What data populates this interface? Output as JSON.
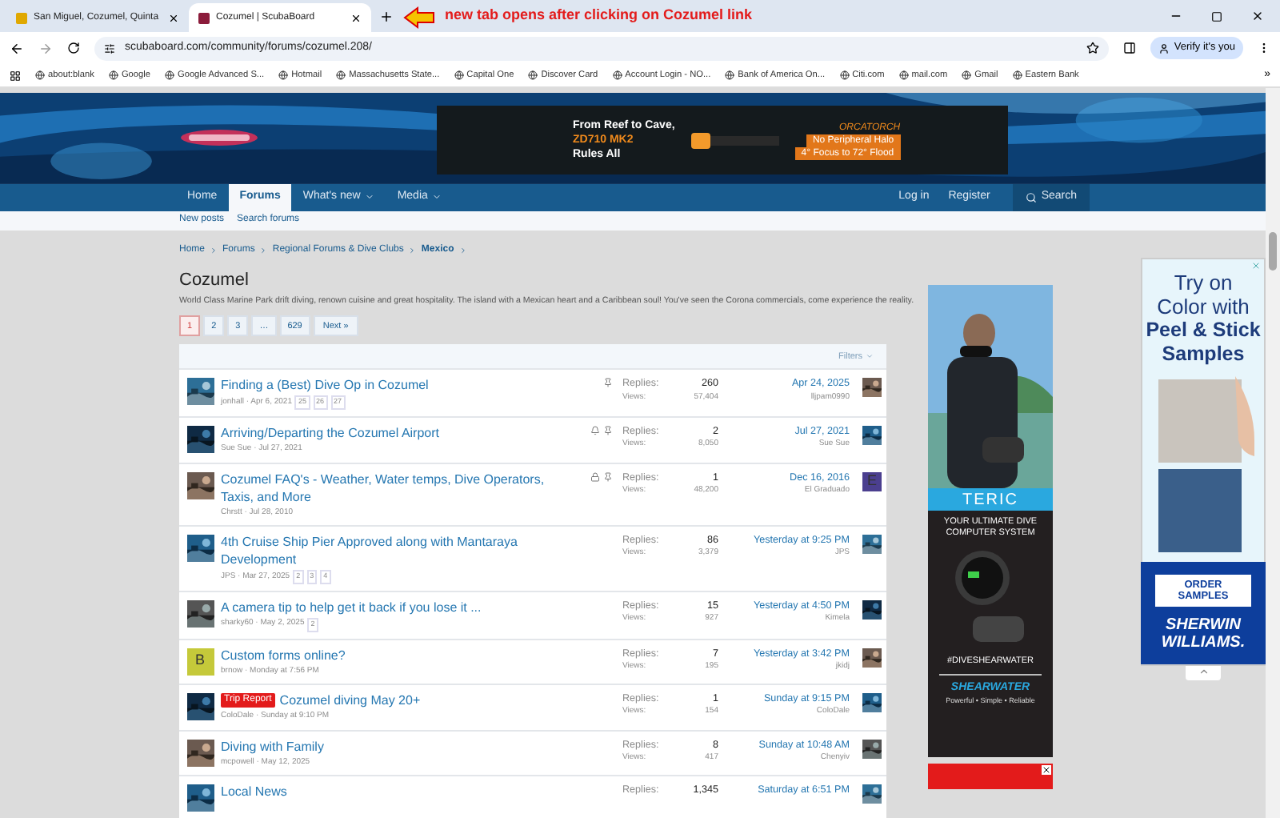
{
  "browser": {
    "tabs": [
      {
        "title": "San Miguel, Cozumel, Quinta",
        "selected": false
      },
      {
        "title": "Cozumel | ScubaBoard",
        "selected": true
      }
    ],
    "annotation": "new tab opens after clicking on Cozumel link",
    "url": "scubaboard.com/community/forums/cozumel.208/",
    "profile_button": "Verify it's you",
    "bookmarks": [
      "about:blank",
      "Google",
      "Google Advanced S...",
      "Hotmail",
      "Massachusetts State...",
      "Capital One",
      "Discover Card",
      "Account Login - NO...",
      "Bank of America On...",
      "Citi.com",
      "mail.com",
      "Gmail",
      "Eastern Bank"
    ],
    "bookmarks_overflow": "»"
  },
  "banner_ad": {
    "headline": "From Reef to Cave,",
    "model": "ZD710 MK2",
    "tagline": "Rules All",
    "brand": "ORCATORCH",
    "feature_1": "No Peripheral Halo",
    "feature_2": "4° Focus to 72° Flood"
  },
  "nav": {
    "items": [
      {
        "label": "Home",
        "selected": false,
        "menu": false
      },
      {
        "label": "Forums",
        "selected": true,
        "menu": false
      },
      {
        "label": "What's new",
        "selected": false,
        "menu": true
      },
      {
        "label": "Media",
        "selected": false,
        "menu": true
      }
    ],
    "login": "Log in",
    "register": "Register",
    "search": "Search",
    "sub_items": [
      "New posts",
      "Search forums"
    ]
  },
  "breadcrumbs": [
    {
      "label": "Home",
      "current": false
    },
    {
      "label": "Forums",
      "current": false
    },
    {
      "label": "Regional Forums & Dive Clubs",
      "current": false
    },
    {
      "label": "Mexico",
      "current": true
    }
  ],
  "title": "Cozumel",
  "description": "World Class Marine Park drift diving, renown cuisine and great hospitality. The island with a Mexican heart and a Caribbean soul! You've seen the Corona commercials, come experience the reality.",
  "pagination": [
    {
      "label": "1",
      "selected": true
    },
    {
      "label": "2",
      "selected": false
    },
    {
      "label": "3",
      "selected": false
    },
    {
      "label": "…",
      "selected": false
    },
    {
      "label": "629",
      "selected": false
    }
  ],
  "next": "Next »",
  "filters": "Filters",
  "threads": [
    {
      "title": "Finding a (Best) Dive Op in Cozumel",
      "meta": "jonhall · Apr 6, 2021",
      "pages": [
        "25",
        "26",
        "27"
      ],
      "status_icons": [
        {
          "kind": "sticky"
        }
      ],
      "replies_label": "Replies:",
      "replies": "260",
      "views_label": "Views:",
      "views": "57,404",
      "last_date": "Apr 24, 2025",
      "last_user": "lljpam0990",
      "avatar": {
        "kind": "picture"
      },
      "last_avatar": {
        "kind": "picture"
      }
    },
    {
      "title": "Arriving/Departing the Cozumel Airport",
      "meta": "Sue Sue · Jul 27, 2021",
      "status_icons": [
        {
          "kind": "watched"
        },
        {
          "kind": "sticky"
        }
      ],
      "replies_label": "Replies:",
      "replies": "2",
      "views_label": "Views:",
      "views": "8,050",
      "last_date": "Jul 27, 2021",
      "last_user": "Sue Sue",
      "avatar": {
        "kind": "picture"
      },
      "last_avatar": {
        "kind": "picture"
      }
    },
    {
      "title": "Cozumel FAQ's - Weather, Water temps, Dive Operators, Taxis, and More",
      "meta": "Chrstt · Jul 28, 2010",
      "status_icons": [
        {
          "kind": "locked"
        },
        {
          "kind": "sticky"
        }
      ],
      "replies_label": "Replies:",
      "replies": "1",
      "views_label": "Views:",
      "views": "48,200",
      "last_date": "Dec 16, 2016",
      "last_user": "El Graduado",
      "avatar": {
        "kind": "picture"
      },
      "last_avatar": {
        "kind": "letter",
        "letter": "E",
        "color": "#4b3f8f"
      }
    },
    {
      "title": "4th Cruise Ship Pier Approved along with Mantaraya Development",
      "meta": "JPS · Mar 27, 2025",
      "pages": [
        "2",
        "3",
        "4"
      ],
      "replies_label": "Replies:",
      "replies": "86",
      "views_label": "Views:",
      "views": "3,379",
      "last_date": "Yesterday at 9:25 PM",
      "last_user": "JPS",
      "avatar": {
        "kind": "picture"
      },
      "last_avatar": {
        "kind": "picture"
      }
    },
    {
      "title": "A camera tip to help get it back if you lose it ...",
      "meta": "sharky60 · May 2, 2025",
      "pages": [
        "2"
      ],
      "replies_label": "Replies:",
      "replies": "15",
      "views_label": "Views:",
      "views": "927",
      "last_date": "Yesterday at 4:50 PM",
      "last_user": "Kimela",
      "avatar": {
        "kind": "picture"
      },
      "last_avatar": {
        "kind": "picture"
      }
    },
    {
      "title": "Custom forms online?",
      "meta": "brnow · Monday at 7:56 PM",
      "replies_label": "Replies:",
      "replies": "7",
      "views_label": "Views:",
      "views": "195",
      "last_date": "Yesterday at 3:42 PM",
      "last_user": "jkidj",
      "avatar": {
        "kind": "letter",
        "letter": "B",
        "color": "#c5c93a"
      },
      "last_avatar": {
        "kind": "picture"
      }
    },
    {
      "prefix": "Trip Report",
      "title": "Cozumel diving May 20+",
      "meta": "ColoDale · Sunday at 9:10 PM",
      "replies_label": "Replies:",
      "replies": "1",
      "views_label": "Views:",
      "views": "154",
      "last_date": "Sunday at 9:15 PM",
      "last_user": "ColoDale",
      "avatar": {
        "kind": "picture"
      },
      "last_avatar": {
        "kind": "picture"
      }
    },
    {
      "title": "Diving with Family",
      "meta": "mcpowell · May 12, 2025",
      "replies_label": "Replies:",
      "replies": "8",
      "views_label": "Views:",
      "views": "417",
      "last_date": "Sunday at 10:48 AM",
      "last_user": "Chenyiv",
      "avatar": {
        "kind": "picture"
      },
      "last_avatar": {
        "kind": "picture"
      }
    },
    {
      "title": "Local News",
      "replies_label": "Replies:",
      "replies": "1,345",
      "last_date": "Saturday at 6:51 PM",
      "avatar": {
        "kind": "picture"
      },
      "last_avatar": {
        "kind": "picture"
      }
    }
  ],
  "side_ad": {
    "brand": "TERIC",
    "headline": "YOUR ULTIMATE DIVE COMPUTER SYSTEM",
    "hashtag": "#DIVESHEARWATER",
    "maker": "SHEARWATER",
    "slogan": "Powerful • Simple • Reliable"
  },
  "paint_ad": {
    "line_1": "Try on Color with",
    "line_2": "Peel & Stick Samples",
    "button": "ORDER SAMPLES",
    "brand": "SHERWIN WILLIAMS."
  }
}
